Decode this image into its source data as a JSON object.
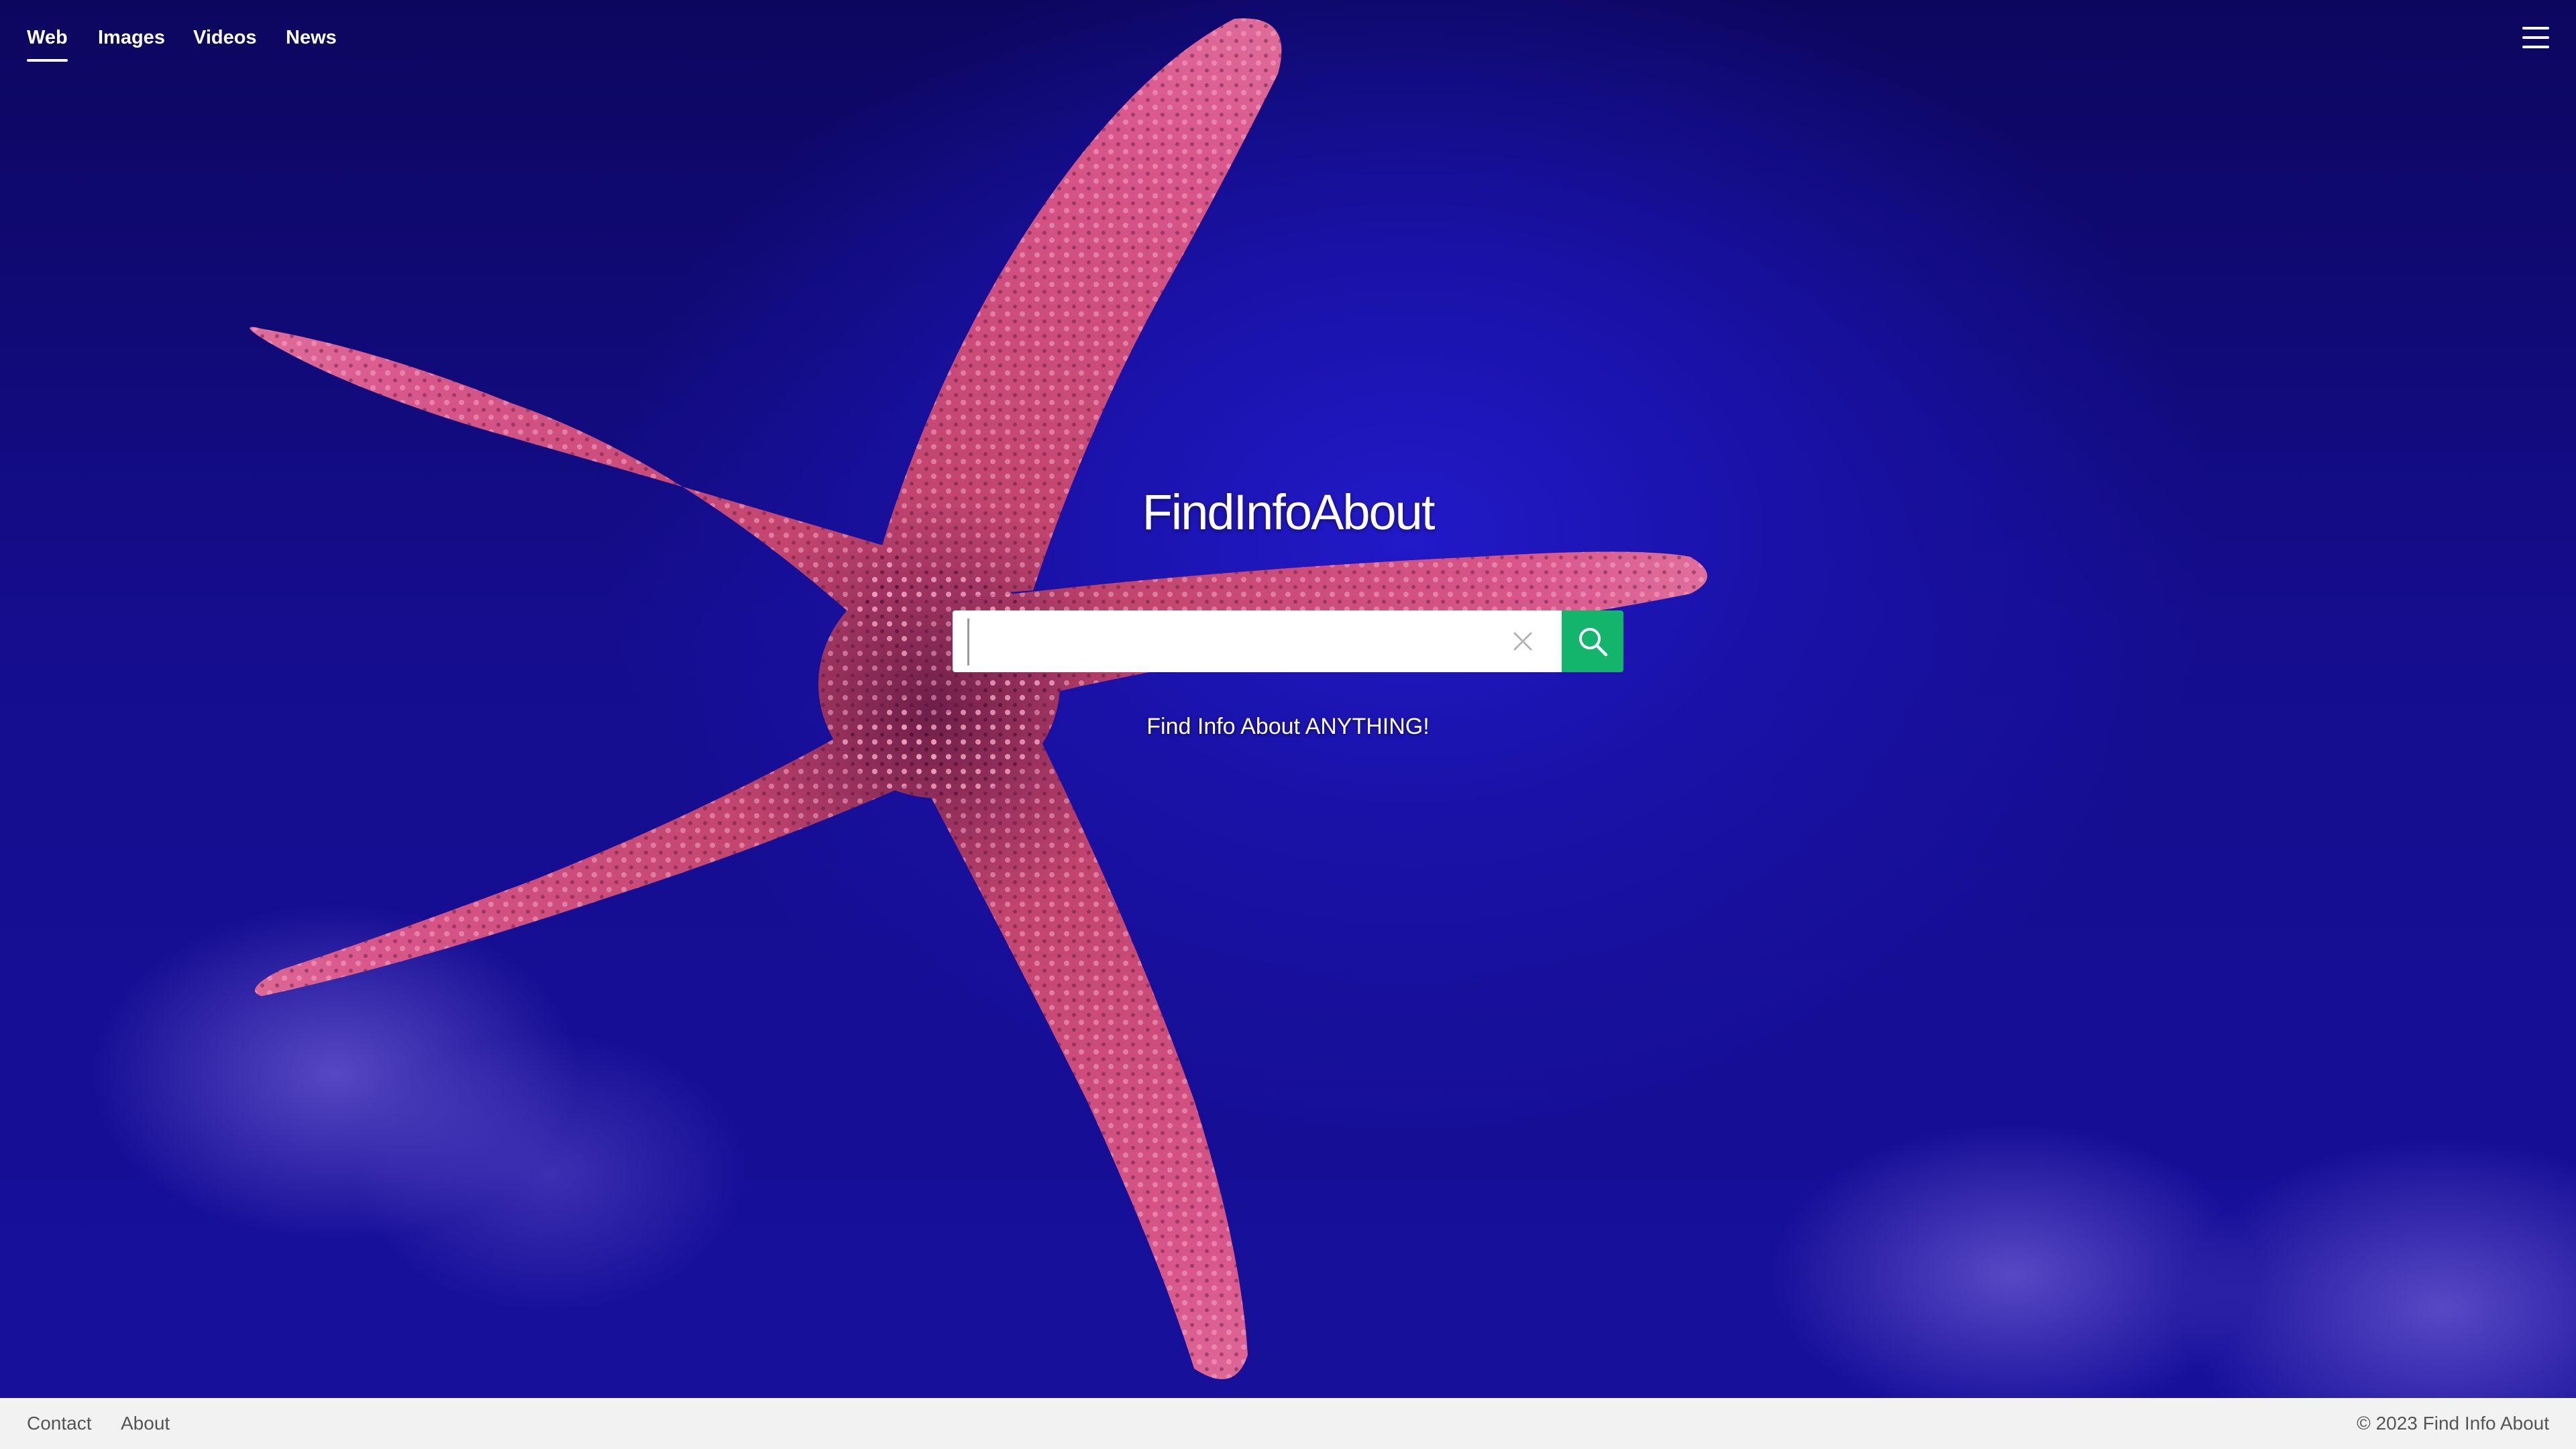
{
  "nav": {
    "tabs": [
      {
        "label": "Web",
        "active": true
      },
      {
        "label": "Images",
        "active": false
      },
      {
        "label": "Videos",
        "active": false
      },
      {
        "label": "News",
        "active": false
      }
    ],
    "menu_icon": "hamburger-menu-icon"
  },
  "logo": {
    "text": "FindInfoAbout"
  },
  "search": {
    "value": "",
    "placeholder": "",
    "clear_icon": "close-icon",
    "button_icon": "search-icon",
    "button_color": "#12b56b"
  },
  "tagline": "Find Info About ANYTHING!",
  "footer": {
    "links": [
      "Contact",
      "About"
    ],
    "copyright": "© 2023 Find Info About"
  },
  "colors": {
    "background": "#17109a",
    "starfish": "#d8557f",
    "footer_bg": "#f2f2f2"
  }
}
